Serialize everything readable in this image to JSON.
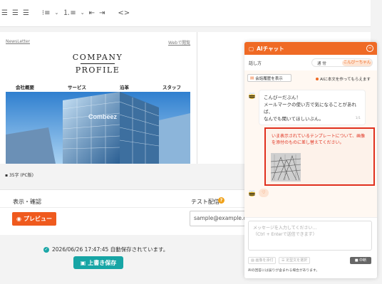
{
  "editor": {
    "news_link": "NewsLetter",
    "web_link": "Webで閲覧",
    "company": "COMPANY",
    "profile": "PROFILE",
    "nav": [
      "会社概要",
      "サービス",
      "沿革",
      "スタッフ"
    ],
    "hero_sign": "Combeez"
  },
  "status": {
    "charcount": "35字 (PC版)"
  },
  "panel": {
    "display_label": "表示・確認",
    "test_label": "テスト配信",
    "preview_label": "プレビュー",
    "email_value": "sample@example.co"
  },
  "autosave": {
    "message": "2026/06/26 17:47:45  自動保存されています。",
    "save_label": "上書き保存"
  },
  "chat": {
    "title": "AIチャット",
    "speak_label": "話し方",
    "toggle_left": "通 常",
    "toggle_right": "こんびーちゃん",
    "history_label": "会話履歴を表示",
    "ai_note": "AIに本文を作ってもらえます",
    "ai_line1": "こんびーだぶん！",
    "ai_line2": "メールマークの使い方で気になることがあれば、",
    "ai_line3": "なんでも聞いてほしいぶん。",
    "ai_time": "1/1",
    "user_line1": "いま表示されているテンプレートについて、画像",
    "user_line2": "を添付のものに差し替えてください。",
    "typing": "♡",
    "input_line1": "メッセージを入力してください…",
    "input_line2": "（Ctrl + Enterで送信できます）",
    "attach_label": "画像を添付",
    "template_label": "定型文を選択",
    "stop_label": "中断",
    "disclaimer": "AIの回答には誤りが含まれる場合があります。"
  },
  "colors": {
    "accent": "#ef6a25",
    "teal": "#17a5a5",
    "alert": "#e0301e"
  }
}
